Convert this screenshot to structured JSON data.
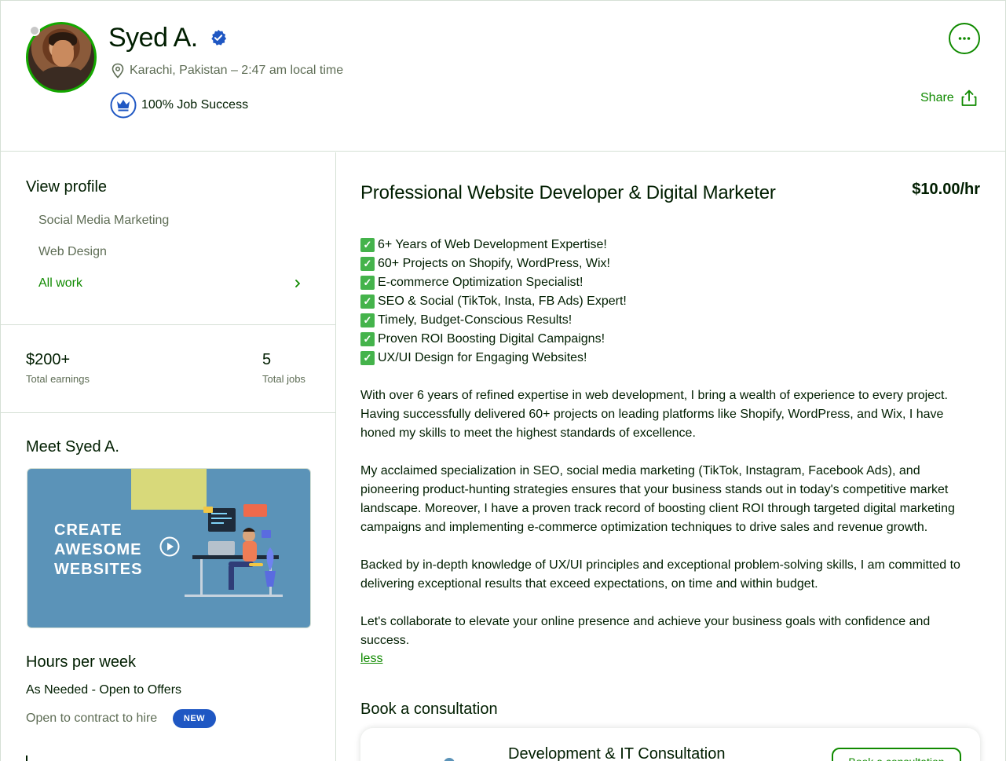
{
  "profile": {
    "name": "Syed A.",
    "location": "Karachi, Pakistan – 2:47 am local time",
    "job_success": "100% Job Success",
    "share_label": "Share"
  },
  "sidebar": {
    "view_profile_title": "View profile",
    "items": [
      {
        "label": "Social Media Marketing"
      },
      {
        "label": "Web Design"
      }
    ],
    "all_work_label": "All work",
    "stats": {
      "earnings_value": "$200+",
      "earnings_label": "Total earnings",
      "jobs_value": "5",
      "jobs_label": "Total jobs"
    },
    "meet_title": "Meet Syed A.",
    "video_text": [
      "CREATE",
      "AWESOME",
      "WEBSITES"
    ],
    "hours_title": "Hours per week",
    "hours_value": "As Needed - Open to Offers",
    "contract_label": "Open to contract to hire",
    "new_badge": "NEW"
  },
  "main": {
    "title": "Professional Website Developer & Digital Marketer",
    "rate": "$10.00/hr",
    "bullets": [
      "6+ Years of Web Development Expertise!",
      "60+ Projects on Shopify, WordPress, Wix!",
      "E-commerce Optimization Specialist!",
      "SEO & Social (TikTok, Insta, FB Ads) Expert!",
      "Timely, Budget-Conscious Results!",
      "Proven ROI Boosting Digital Campaigns!",
      "UX/UI Design for Engaging Websites!"
    ],
    "paragraphs": [
      "With over 6 years of refined expertise in web development, I bring a wealth of experience to every project. Having successfully delivered 60+ projects on leading platforms like Shopify, WordPress, and Wix, I have honed my skills to meet the highest standards of excellence.",
      "My acclaimed specialization in SEO, social media marketing (TikTok, Instagram, Facebook Ads), and pioneering product-hunting strategies ensures that your business stands out in today's competitive market landscape. Moreover, I have a proven track record of boosting client ROI through targeted digital marketing campaigns and implementing e-commerce optimization techniques to drive sales and revenue growth.",
      "Backed by in-depth knowledge of UX/UI principles and exceptional problem-solving skills, I am committed to delivering exceptional results that exceed expectations, on time and within budget.",
      "Let's collaborate to elevate your online presence and achieve your business goals with confidence and success."
    ],
    "less_label": "less",
    "book_title": "Book a consultation",
    "consultation_name": "Development & IT Consultation",
    "book_button": "Book a consultation"
  },
  "colors": {
    "brand_green": "#108a00",
    "badge_blue": "#1f57c3"
  }
}
